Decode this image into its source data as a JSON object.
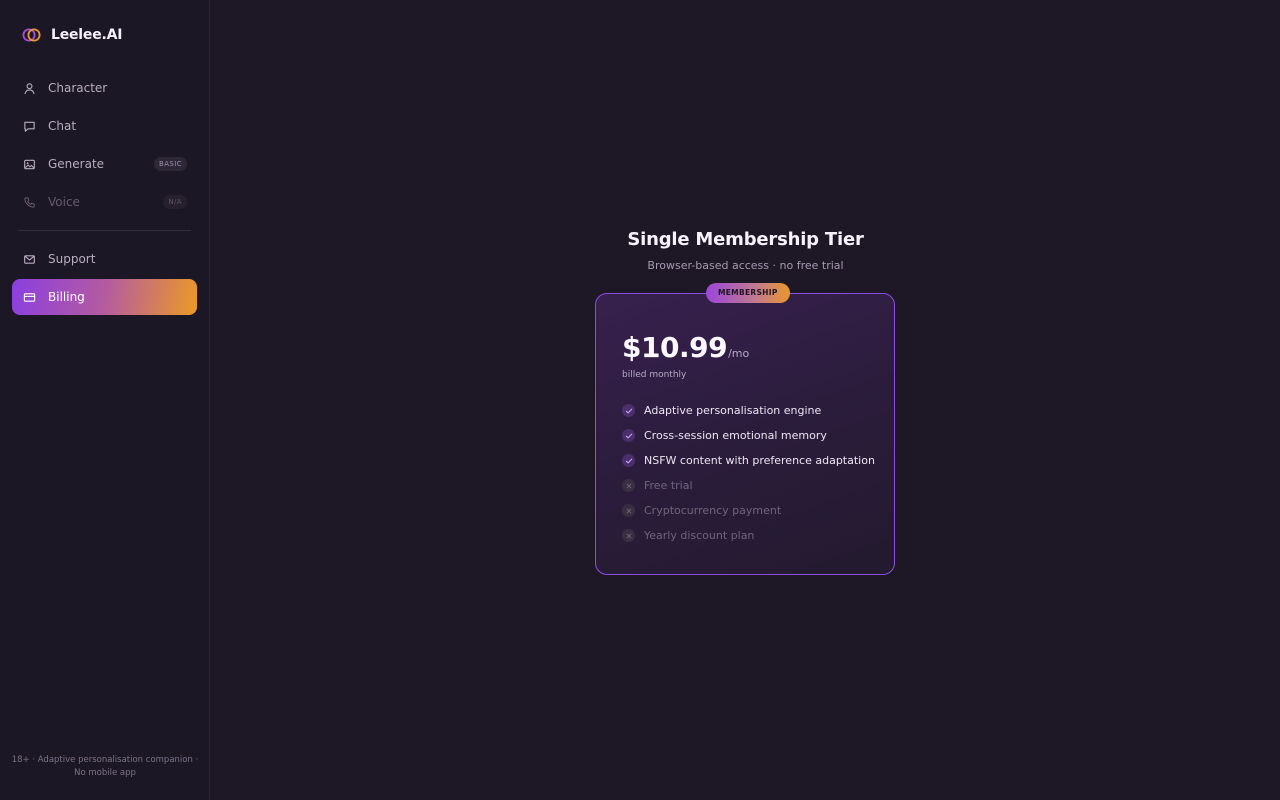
{
  "brand": {
    "name": "Leelee.AI",
    "logo_icon": "rings-logo-icon"
  },
  "sidebar": {
    "items": [
      {
        "label": "Character",
        "icon": "user-icon",
        "badge": "",
        "state": "normal"
      },
      {
        "label": "Chat",
        "icon": "chat-bubble-icon",
        "badge": "",
        "state": "normal"
      },
      {
        "label": "Generate",
        "icon": "image-icon",
        "badge": "BASIC",
        "state": "normal"
      },
      {
        "label": "Voice",
        "icon": "phone-icon",
        "badge": "N/A",
        "state": "disabled"
      },
      {
        "label": "Support",
        "icon": "mail-icon",
        "badge": "",
        "state": "normal"
      },
      {
        "label": "Billing",
        "icon": "credit-card-icon",
        "badge": "",
        "state": "active"
      }
    ],
    "footer": "18+ · Adaptive personalisation companion · No mobile app"
  },
  "main": {
    "title": "Single Membership Tier",
    "subtitle": "Browser-based access · no free trial",
    "card": {
      "badge": "MEMBERSHIP",
      "price": "$10.99",
      "period": "/mo",
      "billing_note": "billed monthly",
      "features": [
        {
          "label": "Adaptive personalisation engine",
          "included": true
        },
        {
          "label": "Cross-session emotional memory",
          "included": true
        },
        {
          "label": "NSFW content with preference adaptation",
          "included": true
        },
        {
          "label": "Free trial",
          "included": false
        },
        {
          "label": "Cryptocurrency payment",
          "included": false
        },
        {
          "label": "Yearly discount plan",
          "included": false
        }
      ]
    }
  },
  "colors": {
    "background": "#1e1826",
    "sidebar": "#1c1724",
    "accent_purple": "#8b3fe0",
    "accent_orange": "#eb9a24",
    "card_border": "#8a4fe0"
  }
}
